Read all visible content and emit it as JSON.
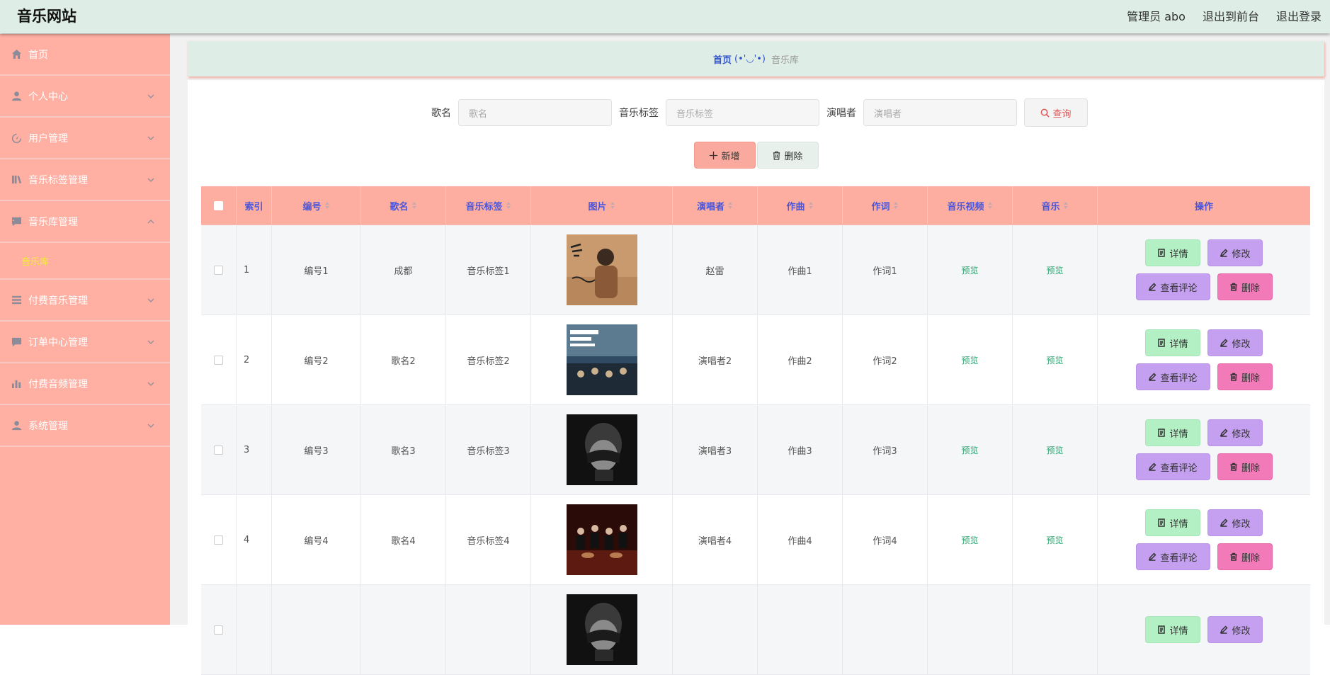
{
  "header": {
    "brand": "音乐网站",
    "links": [
      "管理员 abo",
      "退出到前台",
      "退出登录"
    ]
  },
  "sidebar": {
    "items": [
      {
        "label": "首页",
        "icon": "home-icon",
        "has_arrow": false
      },
      {
        "label": "个人中心",
        "icon": "user-icon",
        "has_arrow": true
      },
      {
        "label": "用户管理",
        "icon": "dashboard-icon",
        "has_arrow": true
      },
      {
        "label": "音乐标签管理",
        "icon": "library-icon",
        "has_arrow": true
      },
      {
        "label": "音乐库管理",
        "icon": "message-icon",
        "has_arrow": true,
        "expanded": true
      },
      {
        "label": "付费音乐管理",
        "icon": "list-icon",
        "has_arrow": true
      },
      {
        "label": "订单中心管理",
        "icon": "comment-icon",
        "has_arrow": true
      },
      {
        "label": "付费音频管理",
        "icon": "bar-chart-icon",
        "has_arrow": true
      },
      {
        "label": "系统管理",
        "icon": "user-icon",
        "has_arrow": true
      }
    ],
    "submenu": "音乐库",
    "colors": {
      "background": "#ffb0a3",
      "active_submenu": "#f4ef37"
    }
  },
  "breadcrumb": {
    "home": "首页",
    "separator": "(•'◡'•)",
    "current": "音乐库"
  },
  "search": {
    "fields": [
      {
        "label": "歌名",
        "placeholder": "歌名"
      },
      {
        "label": "音乐标签",
        "placeholder": "音乐标签"
      },
      {
        "label": "演唱者",
        "placeholder": "演唱者"
      }
    ],
    "button": "查询"
  },
  "actions": {
    "add": "新增",
    "delete": "删除"
  },
  "table": {
    "columns": [
      "",
      "索引",
      "编号",
      "歌名",
      "音乐标签",
      "图片",
      "演唱者",
      "作曲",
      "作词",
      "音乐视频",
      "音乐",
      "操作"
    ],
    "rows": [
      {
        "index": "1",
        "code": "编号1",
        "name": "成都",
        "tag": "音乐标签1",
        "singer": "赵雷",
        "composer": "作曲1",
        "lyricist": "作词1",
        "video": "预览",
        "music": "预览",
        "image": "album-cover-1"
      },
      {
        "index": "2",
        "code": "编号2",
        "name": "歌名2",
        "tag": "音乐标签2",
        "singer": "演唱者2",
        "composer": "作曲2",
        "lyricist": "作词2",
        "video": "预览",
        "music": "预览",
        "image": "album-cover-2"
      },
      {
        "index": "3",
        "code": "编号3",
        "name": "歌名3",
        "tag": "音乐标签3",
        "singer": "演唱者3",
        "composer": "作曲3",
        "lyricist": "作词3",
        "video": "预览",
        "music": "预览",
        "image": "album-cover-3"
      },
      {
        "index": "4",
        "code": "编号4",
        "name": "歌名4",
        "tag": "音乐标签4",
        "singer": "演唱者4",
        "composer": "作曲4",
        "lyricist": "作词4",
        "video": "预览",
        "music": "预览",
        "image": "album-cover-4"
      },
      {
        "index": "",
        "code": "",
        "name": "",
        "tag": "",
        "singer": "",
        "composer": "",
        "lyricist": "",
        "video": "",
        "music": "",
        "image": "album-cover-3"
      }
    ],
    "row_actions": {
      "detail": "详情",
      "edit": "修改",
      "comments": "查看评论",
      "delete": "删除"
    },
    "colors": {
      "header": "#feaea0",
      "header_text": "#4b55d8",
      "preview": "#27a56f"
    }
  }
}
